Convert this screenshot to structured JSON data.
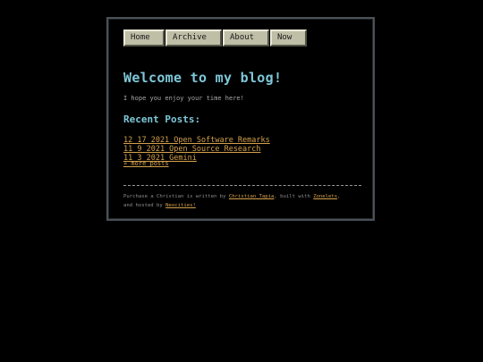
{
  "nav": {
    "items": [
      {
        "label": "Home"
      },
      {
        "label": "Archive"
      },
      {
        "label": "About"
      },
      {
        "label": "Now"
      }
    ]
  },
  "main": {
    "title": "Welcome to my blog!",
    "intro": "I hope you enjoy your time here!",
    "recent_heading": "Recent Posts:",
    "posts": [
      {
        "label": "12 17 2021 Open Software Remarks"
      },
      {
        "label": "11 9 2021 Open Source Research"
      },
      {
        "label": "11 3 2021 Gemini"
      }
    ],
    "more_link": "» more posts"
  },
  "footer": {
    "text_before_author": "Purchase a Christian is written by ",
    "author": "Christian Tapia",
    "text_between": ", built with ",
    "generator": "Zonelets",
    "text_after_generator": ",",
    "text_hosted": "and hosted by ",
    "host": "Neocities!"
  },
  "colors": {
    "background": "#000000",
    "heading": "#7ec8d8",
    "link": "#d4a04a",
    "nav_button": "#bfbfa8",
    "body_text": "#a8a8a8"
  }
}
